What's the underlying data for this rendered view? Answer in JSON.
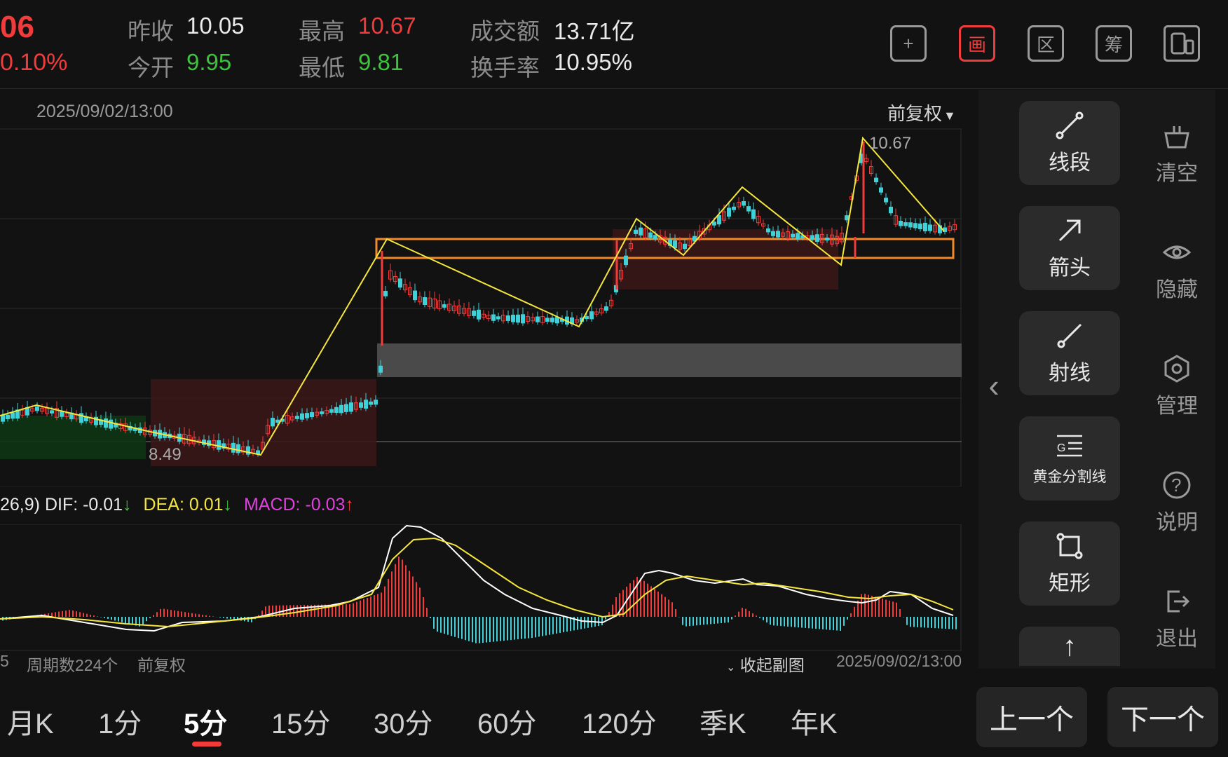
{
  "header": {
    "price_fragment": "06",
    "change_pct": "0.10%",
    "prev_close_label": "昨收",
    "prev_close": "10.05",
    "open_label": "今开",
    "open": "9.95",
    "high_label": "最高",
    "high": "10.67",
    "low_label": "最低",
    "low": "9.81",
    "turnover_label": "成交额",
    "turnover": "13.71亿",
    "turnover_rate_label": "换手率",
    "turnover_rate": "10.95%",
    "toolbar_icons": [
      "plus-icon",
      "draw-icon",
      "range-icon",
      "chips-icon",
      "device-switch-icon"
    ],
    "toolbar_glyphs": [
      "+",
      "画",
      "区",
      "筹",
      "▯"
    ]
  },
  "chart": {
    "date_top": "2025/09/02/13:00",
    "adjust_mode": "前复权",
    "high_marker": "10.67",
    "low_marker": "8.49"
  },
  "macd": {
    "prefix": "26,9)",
    "dif": "DIF: -0.01",
    "dif_arrow": "↓",
    "dea": "DEA: 0.01",
    "dea_arrow": "↓",
    "macd": "MACD: -0.03",
    "macd_arrow": "↑"
  },
  "footer": {
    "left_fragment": "5",
    "period_count": "周期数224个",
    "adjust": "前复权",
    "collapse": "收起副图",
    "date_bottom": "2025/09/02/13:00"
  },
  "tools": {
    "segment": "线段",
    "arrow": "箭头",
    "ray": "射线",
    "fib": "黄金分割线",
    "rect": "矩形",
    "more_glyph": "↑"
  },
  "side_actions": {
    "clear": "清空",
    "hide": "隐藏",
    "manage": "管理",
    "help": "说明",
    "exit": "退出",
    "collapse_glyph": "‹"
  },
  "periods": [
    "月K",
    "1分",
    "5分",
    "15分",
    "30分",
    "60分",
    "120分",
    "季K",
    "年K"
  ],
  "active_period": "5分",
  "nav": {
    "prev": "上一个",
    "next": "下一个"
  },
  "colors": {
    "up": "#f23c3c",
    "down": "#3ec33e",
    "accent": "#f23c3c",
    "trend_line": "#f5e63c",
    "box_orange": "#f08a2a"
  }
}
